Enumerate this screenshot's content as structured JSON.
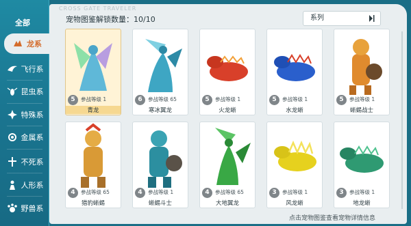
{
  "sidebar": {
    "items": [
      {
        "label": "全部",
        "icon": "none"
      },
      {
        "label": "龙系",
        "icon": "dragon-icon"
      },
      {
        "label": "飞行系",
        "icon": "wing-icon"
      },
      {
        "label": "昆虫系",
        "icon": "insect-icon"
      },
      {
        "label": "特殊系",
        "icon": "special-icon"
      },
      {
        "label": "金属系",
        "icon": "metal-icon"
      },
      {
        "label": "不死系",
        "icon": "undead-icon"
      },
      {
        "label": "人形系",
        "icon": "humanoid-icon"
      },
      {
        "label": "野兽系",
        "icon": "beast-icon"
      }
    ],
    "active_index": 1
  },
  "header": {
    "watermark": "CROSS GATE TRAVELER",
    "unlock_text": "宠物图鉴解锁数量：10/10"
  },
  "filter": {
    "label": "系列"
  },
  "cards": [
    {
      "badge": "5",
      "level": "参战等级 1",
      "name": "青龙",
      "color": "#5fb8d8"
    },
    {
      "badge": "6",
      "level": "参战等级 65",
      "name": "寒冰翼龙",
      "color": "#3ea6c3"
    },
    {
      "badge": "5",
      "level": "参战等级 1",
      "name": "火龙蜥",
      "color": "#d8402a"
    },
    {
      "badge": "5",
      "level": "参战等级 1",
      "name": "水龙蜥",
      "color": "#2a5fcc"
    },
    {
      "badge": "5",
      "level": "参战等级 1",
      "name": "蜥蜴战士",
      "color": "#e08b2e"
    },
    {
      "badge": "4",
      "level": "参战等级 65",
      "name": "猎豹蜥蜴",
      "color": "#d99a36"
    },
    {
      "badge": "4",
      "level": "参战等级 1",
      "name": "蜥蜴斗士",
      "color": "#2c8fa0"
    },
    {
      "badge": "4",
      "level": "参战等级 65",
      "name": "大地翼龙",
      "color": "#39a845"
    },
    {
      "badge": "3",
      "level": "参战等级 1",
      "name": "风龙蜥",
      "color": "#e6d11e"
    },
    {
      "badge": "3",
      "level": "参战等级 1",
      "name": "地龙蜥",
      "color": "#2f9a72"
    }
  ],
  "footer": {
    "hint": "点击宠物图鉴查看宠物详情信息"
  },
  "colors": {
    "accent": "#d46c2c",
    "sidebar": "#1a7590",
    "panel": "#e9eef0"
  }
}
